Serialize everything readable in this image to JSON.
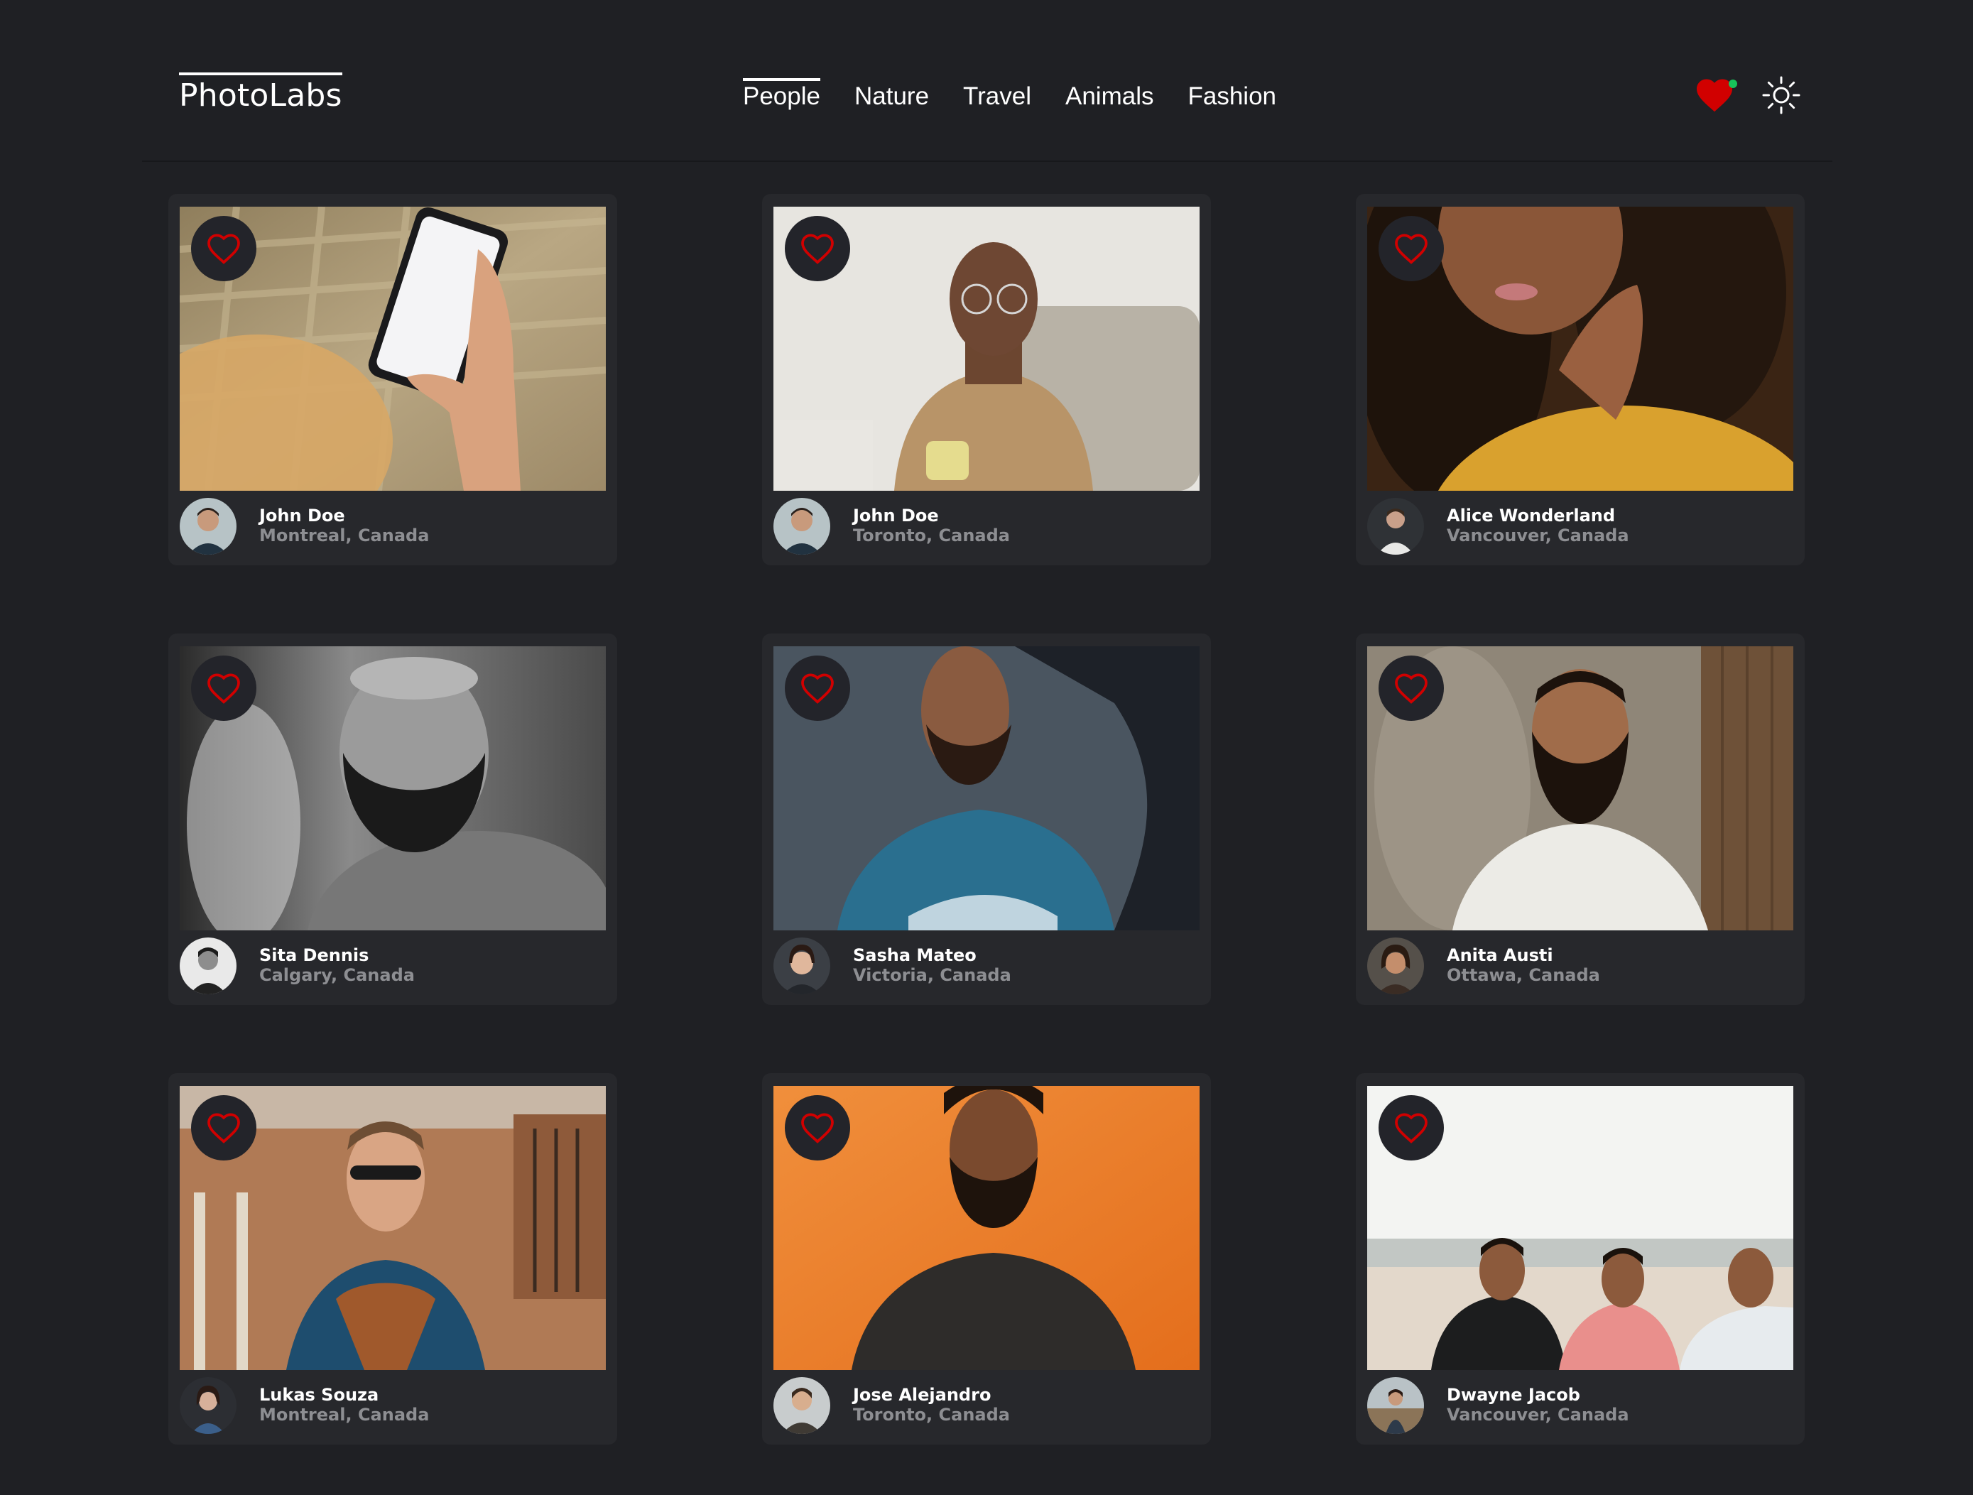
{
  "app": {
    "brand": "PhotoLabs",
    "topics": [
      "People",
      "Nature",
      "Travel",
      "Animals",
      "Fashion"
    ],
    "active_topic": "People",
    "has_favourites": true
  },
  "colors": {
    "background": "#1f2024",
    "card": "#27282c",
    "heart": "#d10000",
    "notify_dot": "#18c25a",
    "secondary_text": "#8d8e92"
  },
  "icons": {
    "favourites": "heart-icon",
    "theme": "sun-icon",
    "like": "heart-outline-icon"
  },
  "photos": [
    {
      "name": "John Doe",
      "location": "Montreal, Canada",
      "favourited": false
    },
    {
      "name": "John Doe",
      "location": "Toronto, Canada",
      "favourited": false
    },
    {
      "name": "Alice Wonderland",
      "location": "Vancouver, Canada",
      "favourited": false
    },
    {
      "name": "Sita Dennis",
      "location": "Calgary, Canada",
      "favourited": false
    },
    {
      "name": "Sasha Mateo",
      "location": "Victoria, Canada",
      "favourited": false
    },
    {
      "name": "Anita Austi",
      "location": "Ottawa, Canada",
      "favourited": false
    },
    {
      "name": "Lukas Souza",
      "location": "Montreal, Canada",
      "favourited": false
    },
    {
      "name": "Jose Alejandro",
      "location": "Toronto, Canada",
      "favourited": false
    },
    {
      "name": "Dwayne Jacob",
      "location": "Vancouver, Canada",
      "favourited": false
    }
  ]
}
